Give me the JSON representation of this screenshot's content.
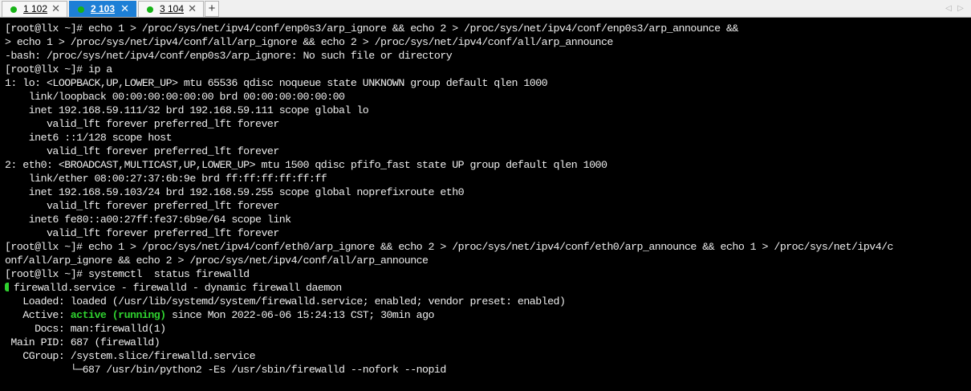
{
  "tabs": [
    {
      "label": "1 102",
      "active": false,
      "close": "✕"
    },
    {
      "label": "2 103",
      "active": true,
      "close": "✕"
    },
    {
      "label": "3 104",
      "active": false,
      "close": "✕"
    }
  ],
  "add_tab_label": "+",
  "nav": {
    "left": "◁",
    "right": "▷"
  },
  "colors": {
    "active_tab": "#1d7fd6",
    "status_dot": "#16b316",
    "terminal_bg": "#000000",
    "terminal_fg": "#ededed",
    "active_green": "#2fd12f"
  },
  "terminal": {
    "lines": [
      "[root@llx ~]# echo 1 > /proc/sys/net/ipv4/conf/enp0s3/arp_ignore && echo 2 > /proc/sys/net/ipv4/conf/enp0s3/arp_announce &&",
      "> echo 1 > /proc/sys/net/ipv4/conf/all/arp_ignore && echo 2 > /proc/sys/net/ipv4/conf/all/arp_announce",
      "-bash: /proc/sys/net/ipv4/conf/enp0s3/arp_ignore: No such file or directory",
      "[root@llx ~]# ip a",
      "1: lo: <LOOPBACK,UP,LOWER_UP> mtu 65536 qdisc noqueue state UNKNOWN group default qlen 1000",
      "    link/loopback 00:00:00:00:00:00 brd 00:00:00:00:00:00",
      "    inet 192.168.59.111/32 brd 192.168.59.111 scope global lo",
      "       valid_lft forever preferred_lft forever",
      "    inet6 ::1/128 scope host",
      "       valid_lft forever preferred_lft forever",
      "2: eth0: <BROADCAST,MULTICAST,UP,LOWER_UP> mtu 1500 qdisc pfifo_fast state UP group default qlen 1000",
      "    link/ether 08:00:27:37:6b:9e brd ff:ff:ff:ff:ff:ff",
      "    inet 192.168.59.103/24 brd 192.168.59.255 scope global noprefixroute eth0",
      "       valid_lft forever preferred_lft forever",
      "    inet6 fe80::a00:27ff:fe37:6b9e/64 scope link",
      "       valid_lft forever preferred_lft forever",
      "[root@llx ~]# echo 1 > /proc/sys/net/ipv4/conf/eth0/arp_ignore && echo 2 > /proc/sys/net/ipv4/conf/eth0/arp_announce && echo 1 > /proc/sys/net/ipv4/c",
      "onf/all/arp_ignore && echo 2 > /proc/sys/net/ipv4/conf/all/arp_announce",
      "[root@llx ~]# systemctl  status firewalld",
      "firewalld.service - firewalld - dynamic firewall daemon",
      "   Loaded: loaded (/usr/lib/systemd/system/firewalld.service; enabled; vendor preset: enabled)",
      "   Active: ",
      "     Docs: man:firewalld(1)",
      " Main PID: 687 (firewalld)",
      "   CGroup: /system.slice/firewalld.service",
      "           └─687 /usr/bin/python2 -Es /usr/sbin/firewalld --nofork --nopid"
    ],
    "active_status": "active (running)",
    "active_rest": " since Mon 2022-06-06 15:24:13 CST; 30min ago"
  }
}
